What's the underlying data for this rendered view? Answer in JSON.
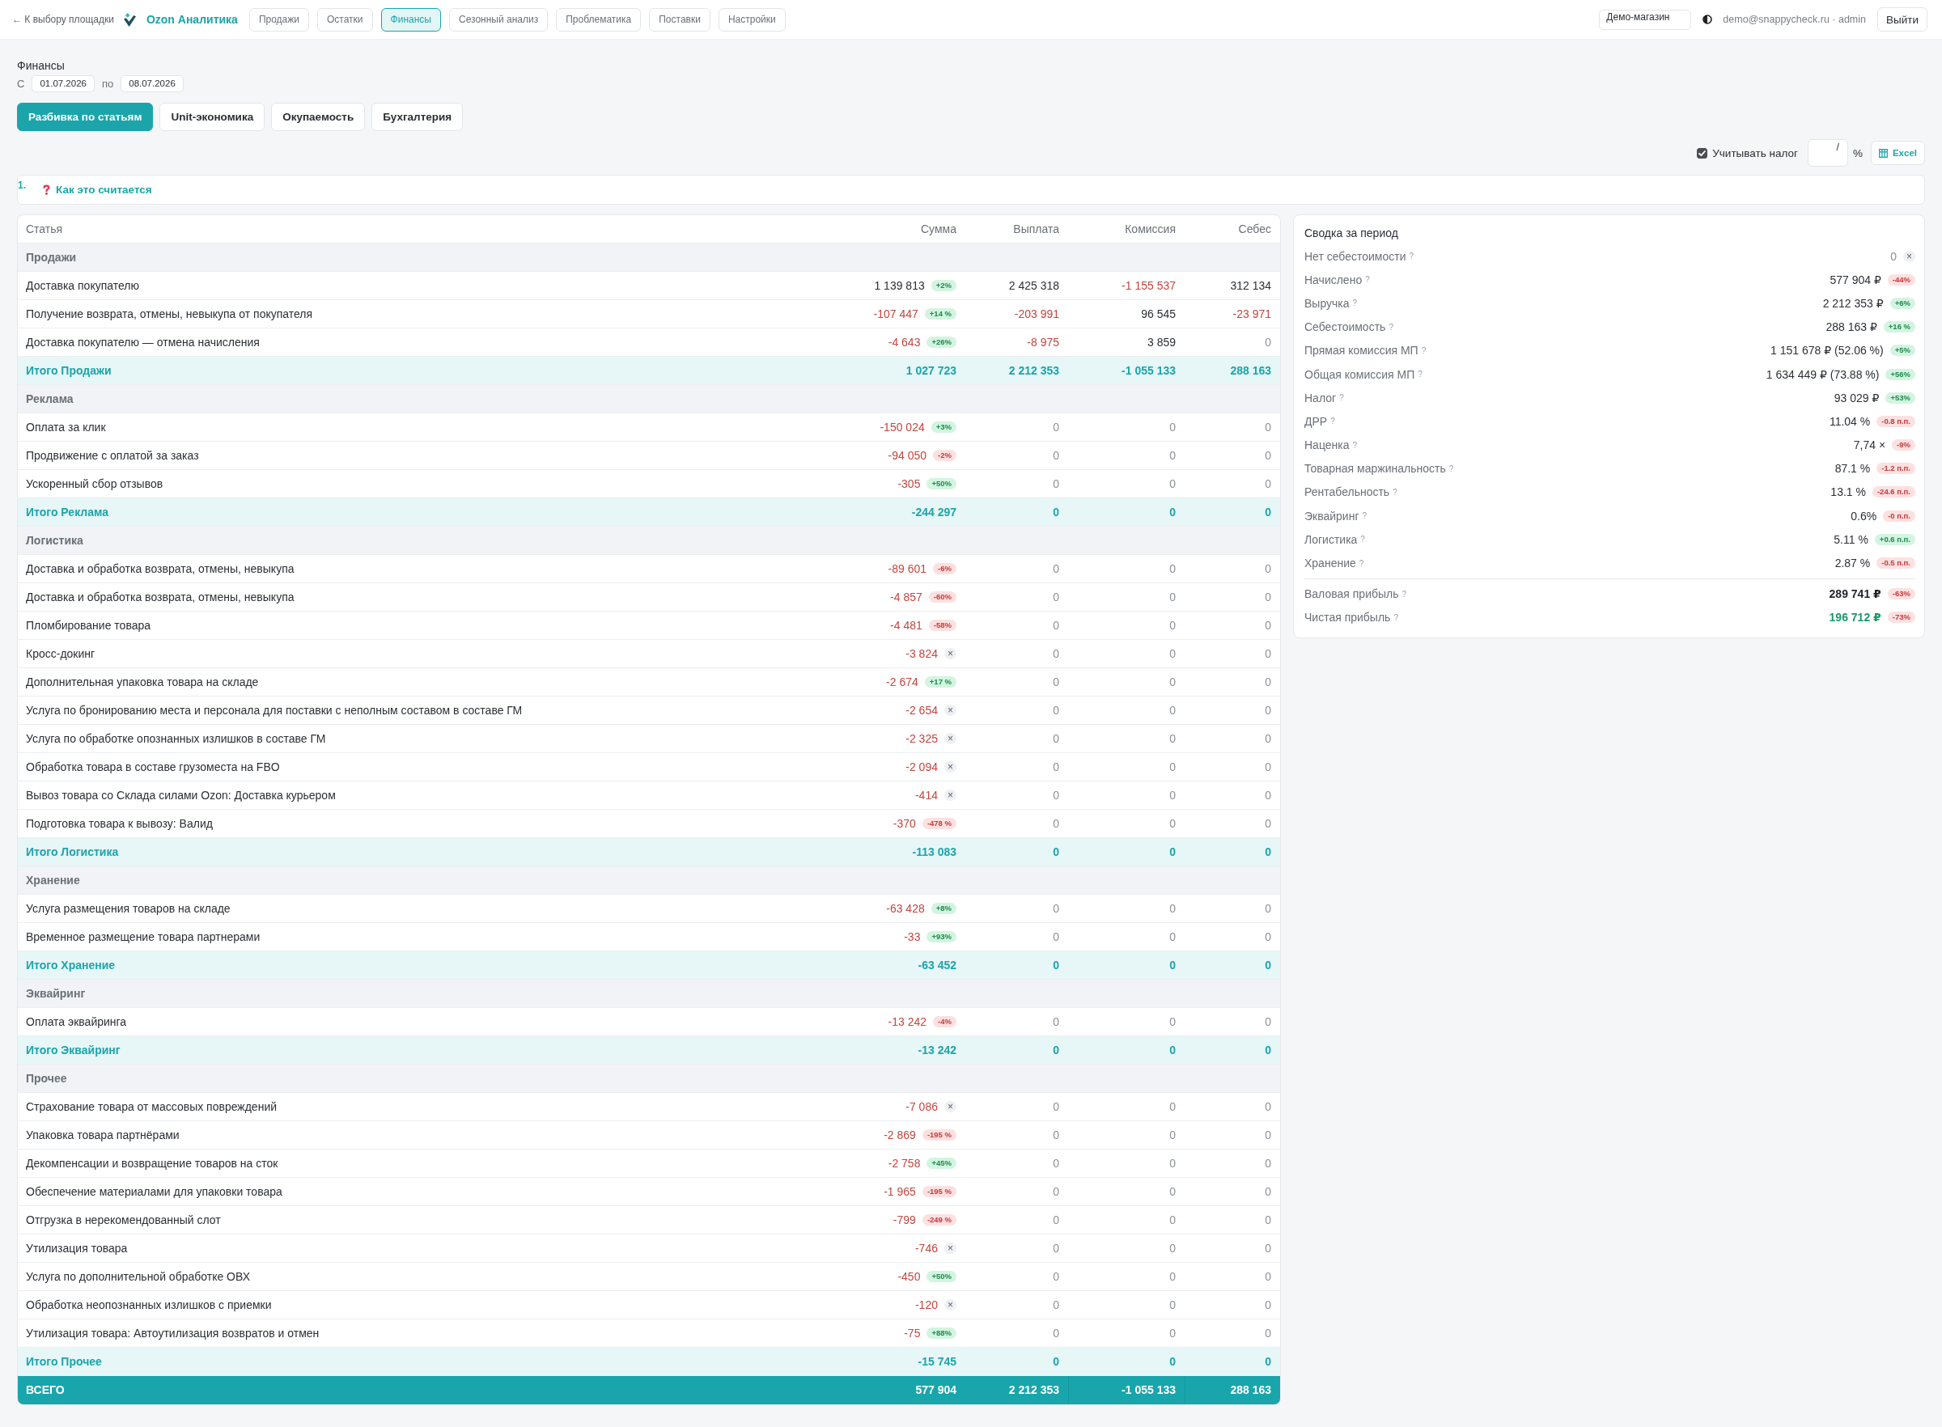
{
  "top_bar": {
    "back_link": "← К выбору площадки",
    "brand": "Ozon Аналитика",
    "tabs": [
      {
        "label": "Продажи",
        "selected": false
      },
      {
        "label": "Остатки",
        "selected": false
      },
      {
        "label": "Финансы",
        "selected": true
      },
      {
        "label": "Сезонный анализ",
        "selected": false
      },
      {
        "label": "Проблематика",
        "selected": false
      },
      {
        "label": "Поставки",
        "selected": false
      },
      {
        "label": "Настройки",
        "selected": false
      }
    ],
    "store": "Демо-магазин",
    "user": "demo@snappycheck.ru · admin",
    "logout": "Выйти"
  },
  "page": {
    "title": "Финансы",
    "date_from_label": "С",
    "date_from": "01.07.2026",
    "date_to_label": "по",
    "date_to": "08.07.2026"
  },
  "views": [
    {
      "label": "Разбивка по статьям",
      "selected": true
    },
    {
      "label": "Unit-экономика",
      "selected": false
    },
    {
      "label": "Окупаемость",
      "selected": false
    },
    {
      "label": "Бухгалтерия",
      "selected": false
    }
  ],
  "controls": {
    "tax": {
      "label": "Учитывать налог",
      "checked": true
    },
    "tax_rate": "/",
    "tax_unit": "%",
    "export": "Excel"
  },
  "info": {
    "number": "1.",
    "link": "Как это считается"
  },
  "table": {
    "columns": [
      "Статья",
      "Сумма",
      "Выплата",
      "Комиссия",
      "Себес"
    ],
    "sections": [
      {
        "title": "Продажи",
        "rows": [
          {
            "label": "Доставка покупателю",
            "cells": [
              {
                "value": "1 139 813",
                "kind": "positive",
                "badge": {
                  "text": "+2%",
                  "kind": "up"
                }
              },
              {
                "value": "2 425 318",
                "kind": "positive"
              },
              {
                "value": "-1 155 537",
                "kind": "negative"
              },
              {
                "value": "312 134",
                "kind": "positive"
              }
            ]
          },
          {
            "label": "Получение возврата, отмены, невыкупа от покупателя",
            "cells": [
              {
                "value": "-107 447",
                "kind": "negative",
                "badge": {
                  "text": "+14 %",
                  "kind": "up"
                }
              },
              {
                "value": "-203 991",
                "kind": "negative"
              },
              {
                "value": "96 545",
                "kind": "positive"
              },
              {
                "value": "-23 971",
                "kind": "negative"
              }
            ]
          },
          {
            "label": "Доставка покупателю — отмена начисления",
            "cells": [
              {
                "value": "-4 643",
                "kind": "negative",
                "badge": {
                  "text": "+26%",
                  "kind": "up"
                }
              },
              {
                "value": "-8 975",
                "kind": "negative"
              },
              {
                "value": "3 859",
                "kind": "positive"
              },
              {
                "value": "0",
                "kind": "zero"
              }
            ]
          }
        ],
        "total": {
          "label": "Итого Продажи",
          "cells": [
            "1 027 723",
            "2 212 353",
            "-1 055 133",
            "288 163"
          ]
        }
      },
      {
        "title": "Реклама",
        "rows": [
          {
            "label": "Оплата за клик",
            "cells": [
              {
                "value": "-150 024",
                "kind": "negative",
                "badge": {
                  "text": "+3%",
                  "kind": "up"
                }
              },
              {
                "value": "0",
                "kind": "zero"
              },
              {
                "value": "0",
                "kind": "zero"
              },
              {
                "value": "0",
                "kind": "zero"
              }
            ]
          },
          {
            "label": "Продвижение с оплатой за заказ",
            "cells": [
              {
                "value": "-94 050",
                "kind": "negative",
                "badge": {
                  "text": "-2%",
                  "kind": "down"
                }
              },
              {
                "value": "0",
                "kind": "zero"
              },
              {
                "value": "0",
                "kind": "zero"
              },
              {
                "value": "0",
                "kind": "zero"
              }
            ]
          },
          {
            "label": "Ускоренный сбор отзывов",
            "cells": [
              {
                "value": "-305",
                "kind": "negative",
                "badge": {
                  "text": "+50%",
                  "kind": "up"
                }
              },
              {
                "value": "0",
                "kind": "zero"
              },
              {
                "value": "0",
                "kind": "zero"
              },
              {
                "value": "0",
                "kind": "zero"
              }
            ]
          }
        ],
        "total": {
          "label": "Итого Реклама",
          "cells": [
            "-244 297",
            "0",
            "0",
            "0"
          ]
        }
      },
      {
        "title": "Логистика",
        "rows": [
          {
            "label": "Доставка и обработка возврата, отмены, невыкупа",
            "cells": [
              {
                "value": "-89 601",
                "kind": "negative",
                "badge": {
                  "text": "-6%",
                  "kind": "down"
                }
              },
              {
                "value": "0",
                "kind": "zero"
              },
              {
                "value": "0",
                "kind": "zero"
              },
              {
                "value": "0",
                "kind": "zero"
              }
            ]
          },
          {
            "label": "Доставка и обработка возврата, отмены, невыкупа",
            "cells": [
              {
                "value": "-4 857",
                "kind": "negative",
                "badge": {
                  "text": "-60%",
                  "kind": "down"
                }
              },
              {
                "value": "0",
                "kind": "zero"
              },
              {
                "value": "0",
                "kind": "zero"
              },
              {
                "value": "0",
                "kind": "zero"
              }
            ]
          },
          {
            "label": "Пломбирование товара",
            "cells": [
              {
                "value": "-4 481",
                "kind": "negative",
                "badge": {
                  "text": "-58%",
                  "kind": "down"
                }
              },
              {
                "value": "0",
                "kind": "zero"
              },
              {
                "value": "0",
                "kind": "zero"
              },
              {
                "value": "0",
                "kind": "zero"
              }
            ]
          },
          {
            "label": "Кросс-докинг",
            "cells": [
              {
                "value": "-3 824",
                "kind": "negative",
                "badge": {
                  "text": "×",
                  "kind": "none"
                }
              },
              {
                "value": "0",
                "kind": "zero"
              },
              {
                "value": "0",
                "kind": "zero"
              },
              {
                "value": "0",
                "kind": "zero"
              }
            ]
          },
          {
            "label": "Дополнительная упаковка товара на складе",
            "cells": [
              {
                "value": "-2 674",
                "kind": "negative",
                "badge": {
                  "text": "+17 %",
                  "kind": "up"
                }
              },
              {
                "value": "0",
                "kind": "zero"
              },
              {
                "value": "0",
                "kind": "zero"
              },
              {
                "value": "0",
                "kind": "zero"
              }
            ]
          },
          {
            "label": "Услуга по бронированию места и персонала для поставки с неполным составом в составе ГМ",
            "cells": [
              {
                "value": "-2 654",
                "kind": "negative",
                "badge": {
                  "text": "×",
                  "kind": "none"
                }
              },
              {
                "value": "0",
                "kind": "zero"
              },
              {
                "value": "0",
                "kind": "zero"
              },
              {
                "value": "0",
                "kind": "zero"
              }
            ]
          },
          {
            "label": "Услуга по обработке опознанных излишков в составе ГМ",
            "cells": [
              {
                "value": "-2 325",
                "kind": "negative",
                "badge": {
                  "text": "×",
                  "kind": "none"
                }
              },
              {
                "value": "0",
                "kind": "zero"
              },
              {
                "value": "0",
                "kind": "zero"
              },
              {
                "value": "0",
                "kind": "zero"
              }
            ]
          },
          {
            "label": "Обработка товара в составе грузоместа на FBO",
            "cells": [
              {
                "value": "-2 094",
                "kind": "negative",
                "badge": {
                  "text": "×",
                  "kind": "none"
                }
              },
              {
                "value": "0",
                "kind": "zero"
              },
              {
                "value": "0",
                "kind": "zero"
              },
              {
                "value": "0",
                "kind": "zero"
              }
            ]
          },
          {
            "label": "Вывоз товара со Склада силами Ozon: Доставка курьером",
            "cells": [
              {
                "value": "-414",
                "kind": "negative",
                "badge": {
                  "text": "×",
                  "kind": "none"
                }
              },
              {
                "value": "0",
                "kind": "zero"
              },
              {
                "value": "0",
                "kind": "zero"
              },
              {
                "value": "0",
                "kind": "zero"
              }
            ]
          },
          {
            "label": "Подготовка товара к вывозу: Валид",
            "cells": [
              {
                "value": "-370",
                "kind": "negative",
                "badge": {
                  "text": "-478 %",
                  "kind": "down"
                }
              },
              {
                "value": "0",
                "kind": "zero"
              },
              {
                "value": "0",
                "kind": "zero"
              },
              {
                "value": "0",
                "kind": "zero"
              }
            ]
          }
        ],
        "total": {
          "label": "Итого Логистика",
          "cells": [
            "-113 083",
            "0",
            "0",
            "0"
          ]
        }
      },
      {
        "title": "Хранение",
        "rows": [
          {
            "label": "Услуга размещения товаров на складе",
            "cells": [
              {
                "value": "-63 428",
                "kind": "negative",
                "badge": {
                  "text": "+8%",
                  "kind": "up"
                }
              },
              {
                "value": "0",
                "kind": "zero"
              },
              {
                "value": "0",
                "kind": "zero"
              },
              {
                "value": "0",
                "kind": "zero"
              }
            ]
          },
          {
            "label": "Временное размещение товара партнерами",
            "cells": [
              {
                "value": "-33",
                "kind": "negative",
                "badge": {
                  "text": "+93%",
                  "kind": "up"
                }
              },
              {
                "value": "0",
                "kind": "zero"
              },
              {
                "value": "0",
                "kind": "zero"
              },
              {
                "value": "0",
                "kind": "zero"
              }
            ]
          }
        ],
        "total": {
          "label": "Итого Хранение",
          "cells": [
            "-63 452",
            "0",
            "0",
            "0"
          ]
        }
      },
      {
        "title": "Эквайринг",
        "rows": [
          {
            "label": "Оплата эквайринга",
            "cells": [
              {
                "value": "-13 242",
                "kind": "negative",
                "badge": {
                  "text": "-4%",
                  "kind": "down"
                }
              },
              {
                "value": "0",
                "kind": "zero"
              },
              {
                "value": "0",
                "kind": "zero"
              },
              {
                "value": "0",
                "kind": "zero"
              }
            ]
          }
        ],
        "total": {
          "label": "Итого Эквайринг",
          "cells": [
            "-13 242",
            "0",
            "0",
            "0"
          ]
        }
      },
      {
        "title": "Прочее",
        "rows": [
          {
            "label": "Страхование товара от массовых повреждений",
            "cells": [
              {
                "value": "-7 086",
                "kind": "negative",
                "badge": {
                  "text": "×",
                  "kind": "none"
                }
              },
              {
                "value": "0",
                "kind": "zero"
              },
              {
                "value": "0",
                "kind": "zero"
              },
              {
                "value": "0",
                "kind": "zero"
              }
            ]
          },
          {
            "label": "Упаковка товара партнёрами",
            "cells": [
              {
                "value": "-2 869",
                "kind": "negative",
                "badge": {
                  "text": "-195 %",
                  "kind": "down"
                }
              },
              {
                "value": "0",
                "kind": "zero"
              },
              {
                "value": "0",
                "kind": "zero"
              },
              {
                "value": "0",
                "kind": "zero"
              }
            ]
          },
          {
            "label": "Декомпенсации и возвращение товаров на сток",
            "cells": [
              {
                "value": "-2 758",
                "kind": "negative",
                "badge": {
                  "text": "+45%",
                  "kind": "up"
                }
              },
              {
                "value": "0",
                "kind": "zero"
              },
              {
                "value": "0",
                "kind": "zero"
              },
              {
                "value": "0",
                "kind": "zero"
              }
            ]
          },
          {
            "label": "Обеспечение материалами для упаковки товара",
            "cells": [
              {
                "value": "-1 965",
                "kind": "negative",
                "badge": {
                  "text": "-195 %",
                  "kind": "down"
                }
              },
              {
                "value": "0",
                "kind": "zero"
              },
              {
                "value": "0",
                "kind": "zero"
              },
              {
                "value": "0",
                "kind": "zero"
              }
            ]
          },
          {
            "label": "Отгрузка в нерекомендованный слот",
            "cells": [
              {
                "value": "-799",
                "kind": "negative",
                "badge": {
                  "text": "-249 %",
                  "kind": "down"
                }
              },
              {
                "value": "0",
                "kind": "zero"
              },
              {
                "value": "0",
                "kind": "zero"
              },
              {
                "value": "0",
                "kind": "zero"
              }
            ]
          },
          {
            "label": "Утилизация товара",
            "cells": [
              {
                "value": "-746",
                "kind": "negative",
                "badge": {
                  "text": "×",
                  "kind": "none"
                }
              },
              {
                "value": "0",
                "kind": "zero"
              },
              {
                "value": "0",
                "kind": "zero"
              },
              {
                "value": "0",
                "kind": "zero"
              }
            ]
          },
          {
            "label": "Услуга по дополнительной обработке ОВХ",
            "cells": [
              {
                "value": "-450",
                "kind": "negative",
                "badge": {
                  "text": "+50%",
                  "kind": "up"
                }
              },
              {
                "value": "0",
                "kind": "zero"
              },
              {
                "value": "0",
                "kind": "zero"
              },
              {
                "value": "0",
                "kind": "zero"
              }
            ]
          },
          {
            "label": "Обработка неопознанных излишков с приемки",
            "cells": [
              {
                "value": "-120",
                "kind": "negative",
                "badge": {
                  "text": "×",
                  "kind": "none"
                }
              },
              {
                "value": "0",
                "kind": "zero"
              },
              {
                "value": "0",
                "kind": "zero"
              },
              {
                "value": "0",
                "kind": "zero"
              }
            ]
          },
          {
            "label": "Утилизация товара: Автоутилизация возвратов и отмен",
            "cells": [
              {
                "value": "-75",
                "kind": "negative",
                "badge": {
                  "text": "+88%",
                  "kind": "up"
                }
              },
              {
                "value": "0",
                "kind": "zero"
              },
              {
                "value": "0",
                "kind": "zero"
              },
              {
                "value": "0",
                "kind": "zero"
              }
            ]
          }
        ],
        "total": {
          "label": "Итого Прочее",
          "cells": [
            "-15 745",
            "0",
            "0",
            "0"
          ]
        }
      }
    ],
    "grand_total": {
      "label": "ВСЕГО",
      "cells": [
        "577 904",
        "2 212 353",
        "-1 055 133",
        "288 163"
      ]
    }
  },
  "summary": {
    "title": "Сводка за период",
    "metrics": [
      {
        "label": "Нет себестоимости",
        "help": "?",
        "value": "0",
        "kind": "muted",
        "badge": {
          "text": "×",
          "kind": "none"
        }
      },
      {
        "label": "Начислено",
        "help": "?",
        "value": "577 904 ₽",
        "kind": "normal",
        "badge": {
          "text": "-44%",
          "kind": "down"
        }
      },
      {
        "label": "Выручка",
        "help": "?",
        "value": "2 212 353 ₽",
        "kind": "normal",
        "badge": {
          "text": "+6%",
          "kind": "up"
        }
      },
      {
        "label": "Себестоимость",
        "help": "?",
        "value": "288 163 ₽",
        "kind": "normal",
        "badge": {
          "text": "+16 %",
          "kind": "up"
        }
      },
      {
        "label": "Прямая комиссия МП",
        "help": "?",
        "value": "1 151 678 ₽ (52.06 %)",
        "kind": "normal",
        "badge": {
          "text": "+5%",
          "kind": "up"
        }
      },
      {
        "label": "Общая комиссия МП",
        "help": "?",
        "value": "1 634 449 ₽ (73.88 %)",
        "kind": "normal",
        "badge": {
          "text": "+56%",
          "kind": "up"
        }
      },
      {
        "label": "Налог",
        "help": "?",
        "value": "93 029 ₽",
        "kind": "normal",
        "badge": {
          "text": "+53%",
          "kind": "up"
        }
      },
      {
        "label": "ДРР",
        "help": "?",
        "value": "11.04 %",
        "kind": "normal",
        "badge": {
          "text": "-0.8 п.п.",
          "kind": "down"
        }
      },
      {
        "label": "Наценка",
        "help": "?",
        "value": "7,74 ×",
        "kind": "normal",
        "badge": {
          "text": "-9%",
          "kind": "down"
        }
      },
      {
        "label": "Товарная маржинальность",
        "help": "?",
        "value": "87.1 %",
        "kind": "normal",
        "badge": {
          "text": "-1.2 п.п.",
          "kind": "down"
        }
      },
      {
        "label": "Рентабельность",
        "help": "?",
        "value": "13.1 %",
        "kind": "normal",
        "badge": {
          "text": "-24.6 п.п.",
          "kind": "down"
        }
      },
      {
        "label": "Эквайринг",
        "help": "?",
        "value": "0.6%",
        "kind": "normal",
        "badge": {
          "text": "-0 п.п.",
          "kind": "down"
        }
      },
      {
        "label": "Логистика",
        "help": "?",
        "value": "5.11 %",
        "kind": "normal",
        "badge": {
          "text": "+0.6 п.п.",
          "kind": "up"
        }
      },
      {
        "label": "Хранение",
        "help": "?",
        "value": "2.87 %",
        "kind": "normal",
        "badge": {
          "text": "-0.5 п.п.",
          "kind": "down"
        }
      }
    ],
    "profits": [
      {
        "label": "Валовая прибыль",
        "help": "?",
        "value": "289 741 ₽",
        "kind": "strong",
        "badge": {
          "text": "-63%",
          "kind": "down"
        }
      },
      {
        "label": "Чистая прибыль",
        "help": "?",
        "value": "196 712 ₽",
        "kind": "profit",
        "badge": {
          "text": "-73%",
          "kind": "down"
        }
      }
    ]
  }
}
